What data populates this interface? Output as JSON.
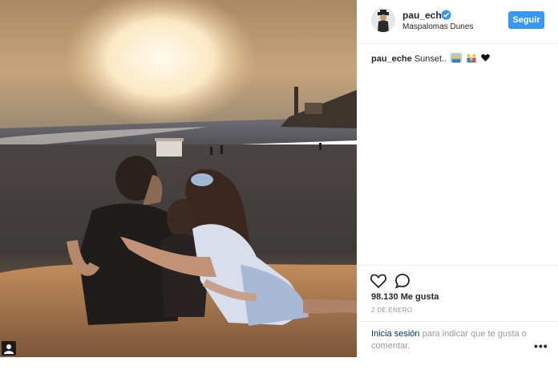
{
  "post": {
    "username": "pau_eche",
    "location": "Maspalomas Dunes",
    "follow_label": "Seguir",
    "caption_username": "pau_eche",
    "caption_text": "Sunset..",
    "likes": "98.130 Me gusta",
    "date": "2 DE ENERO"
  },
  "login_prompt": {
    "link_label": "Inicia sesión",
    "rest_text": "para indicar que te gusta o comentar."
  },
  "icons": {
    "like": "heart-icon",
    "comment": "comment-icon",
    "more": "more-options-icon",
    "verified": "verified-badge-icon",
    "user": "user-icon"
  },
  "colors": {
    "accent": "#3897f0",
    "text": "#262626",
    "muted": "#999999",
    "link": "#003569"
  }
}
